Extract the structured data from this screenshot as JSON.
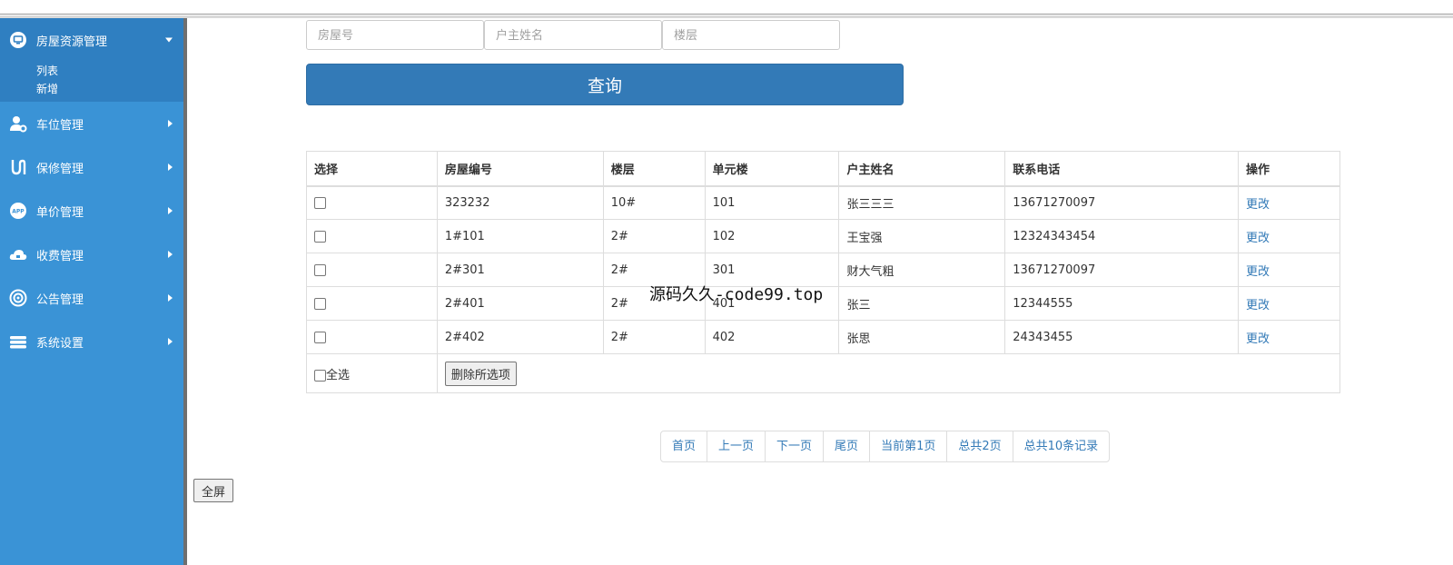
{
  "sidebar": {
    "open_group": {
      "label": "房屋资源管理",
      "icon": "monitor-icon",
      "sub_items": [
        "列表",
        "新增"
      ]
    },
    "items": [
      {
        "label": "车位管理",
        "icon": "user-gear-icon"
      },
      {
        "label": "保修管理",
        "icon": "route-icon"
      },
      {
        "label": "单价管理",
        "icon": "app-icon"
      },
      {
        "label": "收费管理",
        "icon": "cloud-icon"
      },
      {
        "label": "公告管理",
        "icon": "gear-circle-icon"
      },
      {
        "label": "系统设置",
        "icon": "layers-icon"
      }
    ]
  },
  "search": {
    "house_no_placeholder": "房屋号",
    "owner_placeholder": "户主姓名",
    "floor_placeholder": "楼层",
    "query_label": "查询"
  },
  "table": {
    "headers": [
      "选择",
      "房屋编号",
      "楼层",
      "单元楼",
      "户主姓名",
      "联系电话",
      "操作"
    ],
    "rows": [
      {
        "house_no": "323232",
        "floor": "10#",
        "unit": "101",
        "owner": "张三三三",
        "phone": "13671270097",
        "action": "更改"
      },
      {
        "house_no": "1#101",
        "floor": "2#",
        "unit": "102",
        "owner": "王宝强",
        "phone": "12324343454",
        "action": "更改"
      },
      {
        "house_no": "2#301",
        "floor": "2#",
        "unit": "301",
        "owner": "财大气粗",
        "phone": "13671270097",
        "action": "更改"
      },
      {
        "house_no": "2#401",
        "floor": "2#",
        "unit": "401",
        "owner": "张三",
        "phone": "12344555",
        "action": "更改"
      },
      {
        "house_no": "2#402",
        "floor": "2#",
        "unit": "402",
        "owner": "张思",
        "phone": "24343455",
        "action": "更改"
      }
    ],
    "select_all_label": "全选",
    "delete_selected_label": "删除所选项"
  },
  "pager": {
    "first": "首页",
    "prev": "上一页",
    "next": "下一页",
    "last": "尾页",
    "current": "当前第1页",
    "total_pages": "总共2页",
    "total_records": "总共10条记录"
  },
  "fullscreen_label": "全屏",
  "watermark": "源码久久-code99.top",
  "colors": {
    "sidebar": "#3a93d6",
    "sidebar_active": "#2f7fc1",
    "primary": "#337ab7"
  }
}
